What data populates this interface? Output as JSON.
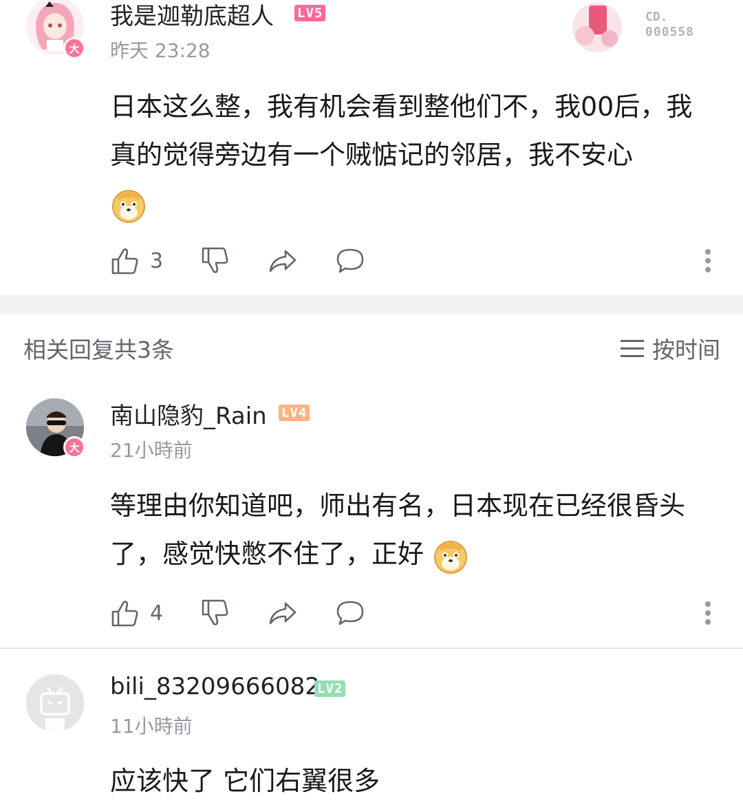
{
  "main_comment": {
    "username": "我是迦勒底超人",
    "level": "LV5",
    "time": "昨天 23:28",
    "vip_badge": "大",
    "content": "日本这么整，我有机会看到整他们不，我00后，我真的觉得旁边有一个贼惦记的邻居，我不安心",
    "emoji": "doge-emoji",
    "likes": "3",
    "decoration_label": "CD.",
    "decoration_number": "000558"
  },
  "replies_header": {
    "count_text": "相关回复共3条",
    "sort_label": "按时间"
  },
  "replies": [
    {
      "username": "南山隐豹_Rain",
      "level": "LV4",
      "time": "21小時前",
      "vip_badge": "大",
      "content": "等理由你知道吧，师出有名，日本现在已经很昏头了，感觉快憋不住了，正好",
      "likes": "4"
    },
    {
      "username": "bili_83209666082",
      "level": "LV2",
      "time": "11小時前",
      "content": "应该快了 它们右翼很多"
    }
  ],
  "colors": {
    "lv5": "#ff6699",
    "lv4": "#ffb37c",
    "lv2": "#95ddb2",
    "vip": "#fb7299",
    "muted_text": "#9499a0",
    "separator": "#f1f2f3"
  }
}
